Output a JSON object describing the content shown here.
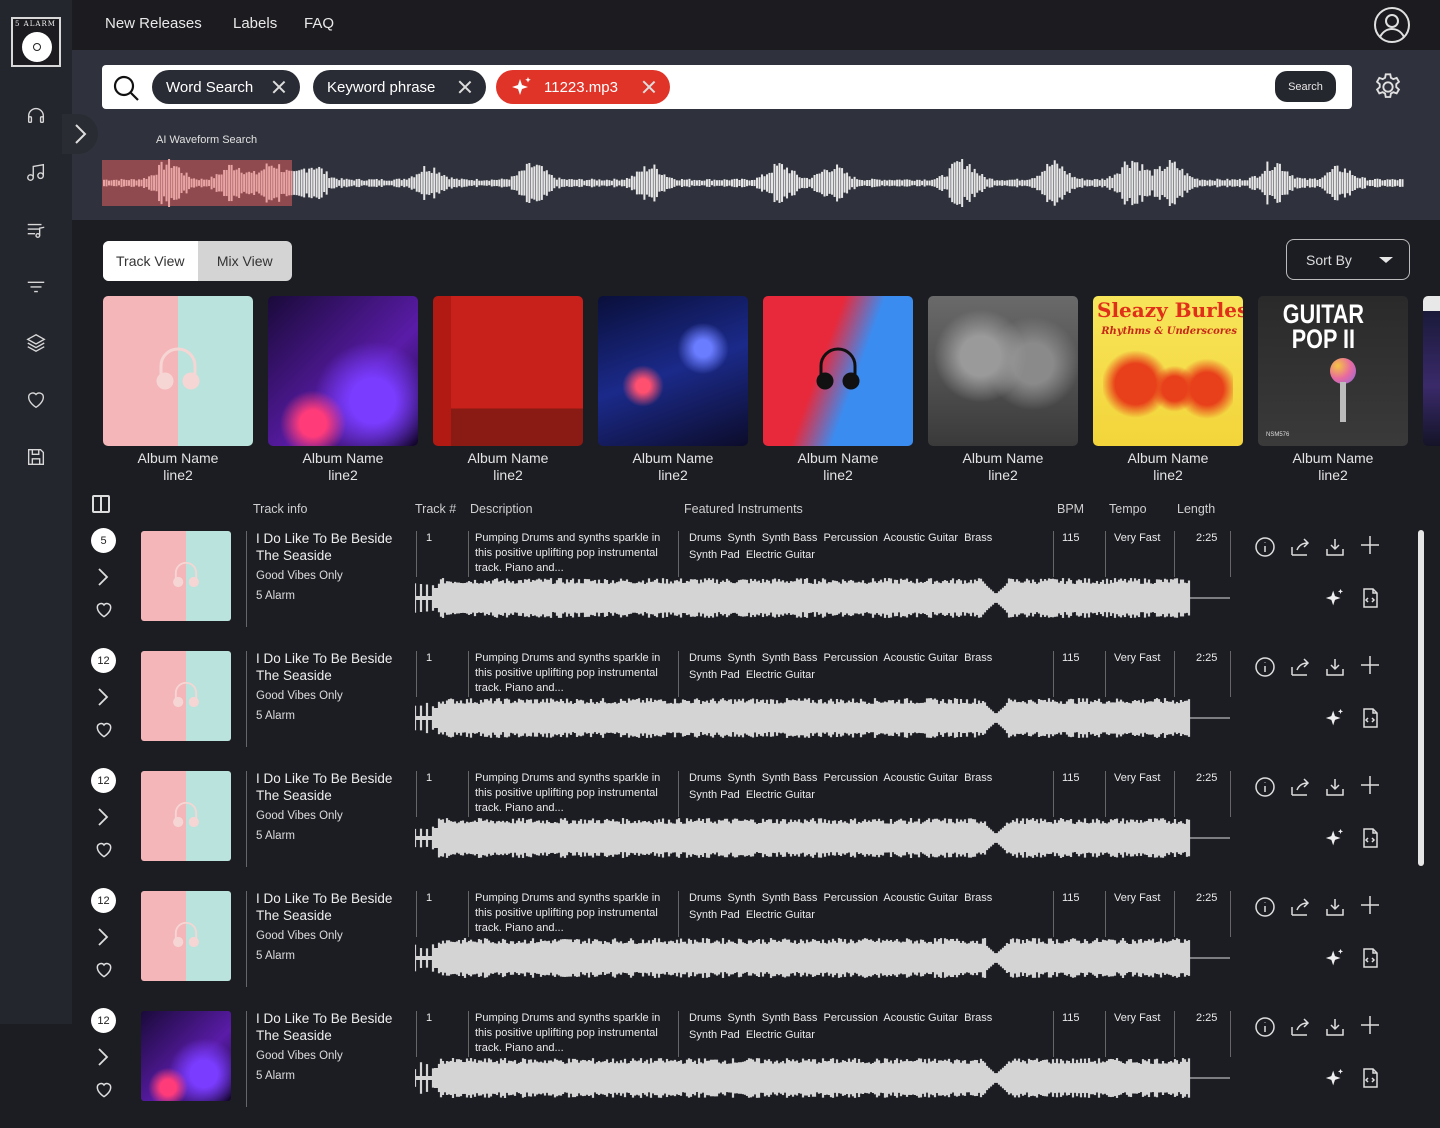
{
  "logo": {
    "text": "5 ALARM"
  },
  "nav": {
    "items": [
      "New Releases",
      "Labels",
      "FAQ"
    ]
  },
  "sidebar": {
    "icons": [
      "headphones-icon",
      "music-note-icon",
      "playlist-icon",
      "filter-icon",
      "layers-icon",
      "heart-icon",
      "save-icon"
    ]
  },
  "search": {
    "chips": [
      {
        "label": "Word Search",
        "type": "text"
      },
      {
        "label": "Keyword phrase",
        "type": "text"
      },
      {
        "label": "11223.mp3",
        "type": "ai-audio"
      }
    ],
    "button_label": "Search",
    "waveform_label": "AI Waveform Search",
    "selection_fraction": 0.146
  },
  "view_toggle": {
    "options": [
      "Track View",
      "Mix View"
    ],
    "active": "Track View"
  },
  "sort": {
    "label": "Sort By"
  },
  "albums": [
    {
      "line1": "Album Name",
      "line2": "line2",
      "art": "pastel-headphones"
    },
    {
      "line1": "Album Name",
      "line2": "line2",
      "art": "purple-dj"
    },
    {
      "line1": "Album Name",
      "line2": "line2",
      "art": "red-room"
    },
    {
      "line1": "Album Name",
      "line2": "line2",
      "art": "blue-mixer"
    },
    {
      "line1": "Album Name",
      "line2": "line2",
      "art": "red-blue-headphones"
    },
    {
      "line1": "Album Name",
      "line2": "line2",
      "art": "stone-sculpture"
    },
    {
      "line1": "Album Name",
      "line2": "line2",
      "art": "sleazy-burlesque",
      "title": "Sleazy Burlesque",
      "subtitle": "Rhythms & Underscores"
    },
    {
      "line1": "Album Name",
      "line2": "line2",
      "art": "guitar-pop",
      "title": "GUITAR POP II",
      "code": "NSM576"
    }
  ],
  "table": {
    "headers": {
      "track_info": "Track info",
      "track_num": "Track #",
      "description": "Description",
      "instruments": "Featured Instruments",
      "bpm": "BPM",
      "tempo": "Tempo",
      "length": "Length"
    },
    "rows": [
      {
        "badge": "5",
        "title": "I Do Like To Be Beside The Seaside",
        "album": "Good Vibes Only",
        "label": "5 Alarm",
        "track_num": "1",
        "description": "Pumping Drums and synths sparkle in this positive uplifting pop instrumental track. Piano and...",
        "instruments_line1": "Drums  Synth  Synth Bass  Percussion  Acoustic Guitar  Brass",
        "instruments_line2": "Synth Pad  Electric Guitar",
        "bpm": "115",
        "tempo": "Very Fast",
        "length": "2:25",
        "art": "pastel-headphones"
      },
      {
        "badge": "12",
        "title": "I Do Like To Be Beside The Seaside",
        "album": "Good Vibes Only",
        "label": "5 Alarm",
        "track_num": "1",
        "description": "Pumping Drums and synths sparkle in this positive uplifting pop instrumental track. Piano and...",
        "instruments_line1": "Drums  Synth  Synth Bass  Percussion  Acoustic Guitar  Brass",
        "instruments_line2": "Synth Pad  Electric Guitar",
        "bpm": "115",
        "tempo": "Very Fast",
        "length": "2:25",
        "art": "pastel-headphones"
      },
      {
        "badge": "12",
        "title": "I Do Like To Be Beside The Seaside",
        "album": "Good Vibes Only",
        "label": "5 Alarm",
        "track_num": "1",
        "description": "Pumping Drums and synths sparkle in this positive uplifting pop instrumental track. Piano and...",
        "instruments_line1": "Drums  Synth  Synth Bass  Percussion  Acoustic Guitar  Brass",
        "instruments_line2": "Synth Pad  Electric Guitar",
        "bpm": "115",
        "tempo": "Very Fast",
        "length": "2:25",
        "art": "pastel-headphones"
      },
      {
        "badge": "12",
        "title": "I Do Like To Be Beside The Seaside",
        "album": "Good Vibes Only",
        "label": "5 Alarm",
        "track_num": "1",
        "description": "Pumping Drums and synths sparkle in this positive uplifting pop instrumental track. Piano and...",
        "instruments_line1": "Drums  Synth  Synth Bass  Percussion  Acoustic Guitar  Brass",
        "instruments_line2": "Synth Pad  Electric Guitar",
        "bpm": "115",
        "tempo": "Very Fast",
        "length": "2:25",
        "art": "pastel-headphones"
      },
      {
        "badge": "12",
        "title": "I Do Like To Be Beside The Seaside",
        "album": "Good Vibes Only",
        "label": "5 Alarm",
        "track_num": "1",
        "description": "Pumping Drums and synths sparkle in this positive uplifting pop instrumental track. Piano and...",
        "instruments_line1": "Drums  Synth  Synth Bass  Percussion  Acoustic Guitar  Brass",
        "instruments_line2": "Synth Pad  Electric Guitar",
        "bpm": "115",
        "tempo": "Very Fast",
        "length": "2:25",
        "art": "purple-dj"
      }
    ]
  },
  "colors": {
    "accent": "#e03429",
    "selection": "#8e4a4e",
    "panel": "#2f323c",
    "background": "#1c1d22"
  }
}
